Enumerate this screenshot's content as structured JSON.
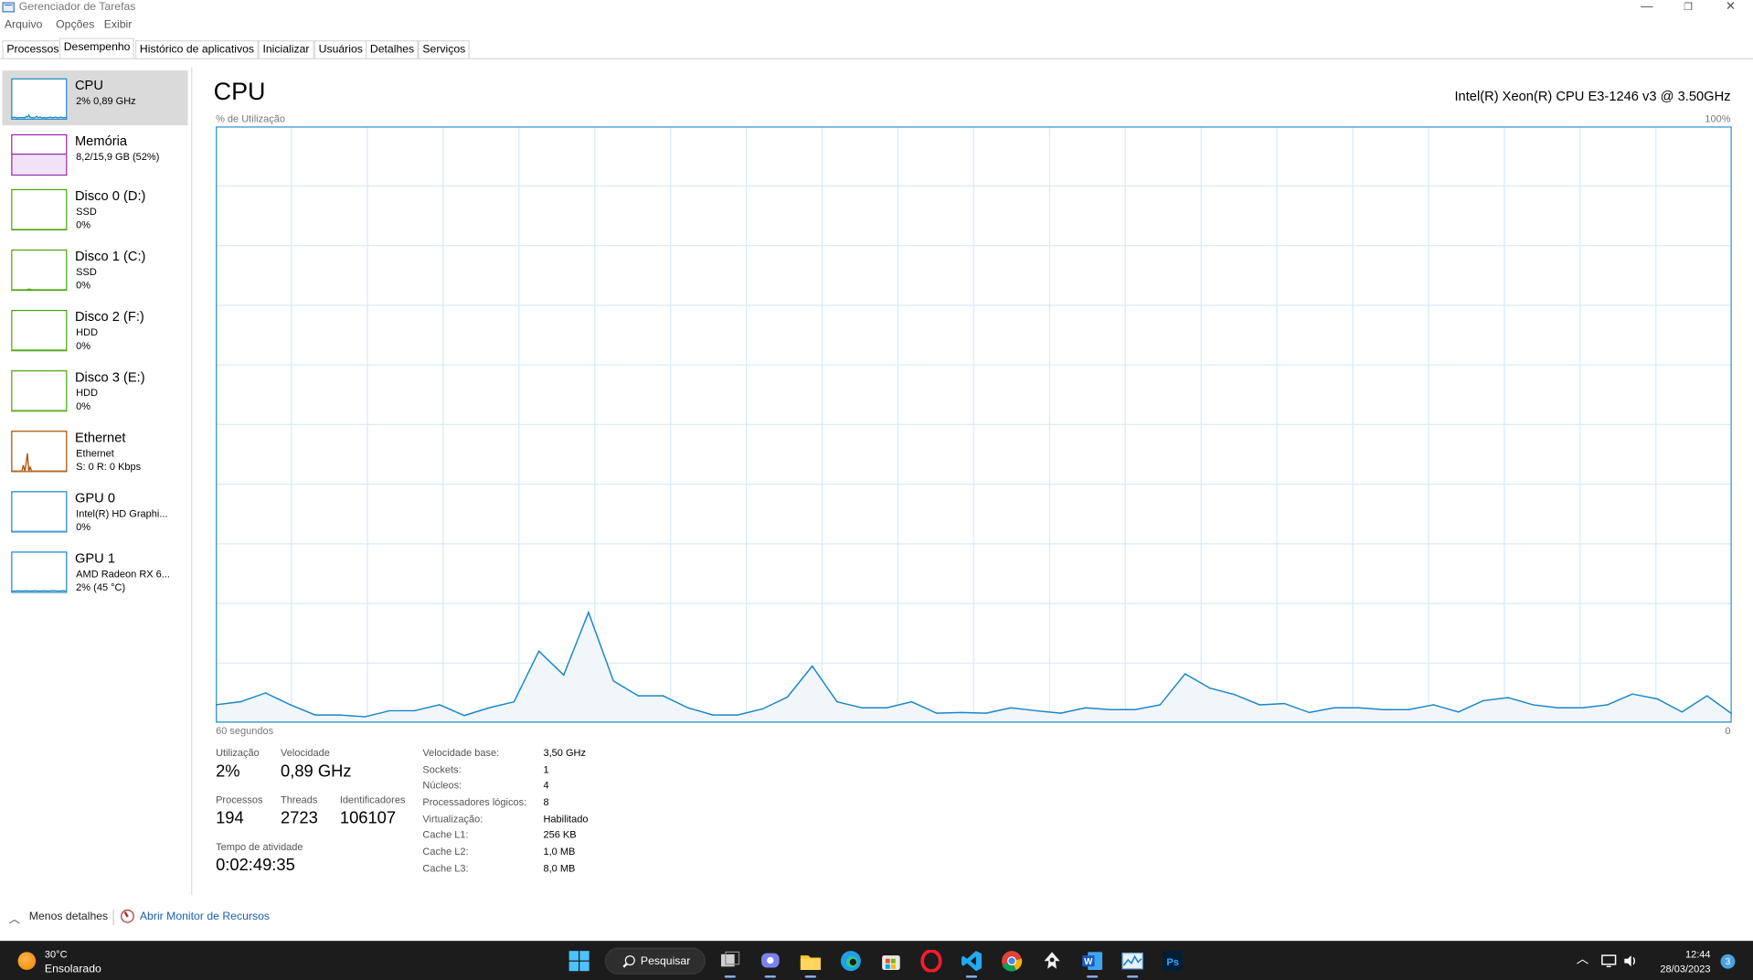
{
  "window": {
    "title": "Gerenciador de Tarefas",
    "controls": {
      "minimize": "—",
      "restore": "❐",
      "close": "✕"
    }
  },
  "menu": [
    "Arquivo",
    "Opções",
    "Exibir"
  ],
  "tabs": [
    "Processos",
    "Desempenho",
    "Histórico de aplicativos",
    "Inicializar",
    "Usuários",
    "Detalhes",
    "Serviços"
  ],
  "active_tab": "Desempenho",
  "sidebar": {
    "items": [
      {
        "title": "CPU",
        "line1": "2% 0,89 GHz",
        "line2": "",
        "color": "#1a86c7",
        "fill": "#dbeaf6",
        "selected": true,
        "spark": [
          3,
          3,
          4,
          2,
          2,
          2,
          3,
          3,
          2,
          3,
          2,
          6,
          4,
          9,
          3,
          3,
          2,
          2,
          3,
          6,
          3,
          3,
          4,
          2,
          2,
          3,
          2,
          2,
          3,
          3,
          4,
          2,
          3,
          3,
          4,
          3,
          2,
          3,
          4,
          3,
          2,
          3,
          2
        ]
      },
      {
        "title": "Memória",
        "line1": "8,2/15,9 GB (52%)",
        "line2": "",
        "color": "#9528b4",
        "fill": "#f1e2f6",
        "selected": false,
        "spark": [
          52,
          52,
          52,
          52,
          52,
          52,
          52,
          52,
          52,
          52
        ]
      },
      {
        "title": "Disco 0 (D:)",
        "line1": "SSD",
        "line2": "0%",
        "color": "#4da60c",
        "fill": "#e6f3dc",
        "selected": false,
        "spark": [
          0,
          0,
          0,
          0,
          0,
          0,
          0,
          0,
          0,
          0
        ]
      },
      {
        "title": "Disco 1 (C:)",
        "line1": "SSD",
        "line2": "0%",
        "color": "#4da60c",
        "fill": "#e6f3dc",
        "selected": false,
        "spark": [
          0,
          0,
          0,
          0,
          0,
          0,
          2,
          0,
          0,
          0,
          0,
          0,
          0,
          0,
          0,
          0,
          0,
          0,
          0,
          0
        ]
      },
      {
        "title": "Disco 2 (F:)",
        "line1": "HDD",
        "line2": "0%",
        "color": "#4da60c",
        "fill": "#e6f3dc",
        "selected": false,
        "spark": [
          0,
          0,
          0,
          0,
          0,
          0,
          0,
          0,
          0,
          0
        ]
      },
      {
        "title": "Disco 3 (E:)",
        "line1": "HDD",
        "line2": "0%",
        "color": "#4da60c",
        "fill": "#e6f3dc",
        "selected": false,
        "spark": [
          0,
          0,
          0,
          0,
          0,
          0,
          0,
          0,
          0,
          0
        ]
      },
      {
        "title": "Ethernet",
        "line1": "Ethernet",
        "line2": "S: 0 R: 0 Kbps",
        "color": "#a74f01",
        "fill": "#f5e4d6",
        "selected": false,
        "spark": [
          0,
          0,
          0,
          0,
          0,
          0,
          0,
          0,
          15,
          0,
          20,
          45,
          0,
          10,
          0,
          0,
          0,
          0,
          0,
          0,
          0,
          0,
          0,
          0,
          0,
          0,
          0,
          0,
          0,
          0,
          0,
          0,
          0,
          0,
          0,
          0,
          0,
          0,
          0,
          0
        ]
      },
      {
        "title": "GPU 0",
        "line1": "Intel(R) HD Graphi...",
        "line2": "0%",
        "color": "#1a86c7",
        "fill": "#dbeaf6",
        "selected": false,
        "spark": [
          0,
          0,
          0,
          0,
          0,
          0,
          0,
          0,
          0,
          0
        ]
      },
      {
        "title": "GPU 1",
        "line1": "AMD Radeon RX 6...",
        "line2": "2% (45 °C)",
        "color": "#1a86c7",
        "fill": "#dbeaf6",
        "selected": false,
        "spark": [
          2,
          2,
          3,
          2,
          2,
          3,
          2,
          2,
          3,
          2,
          2,
          3,
          2,
          2,
          3,
          3,
          2,
          2,
          3,
          2
        ]
      }
    ]
  },
  "main": {
    "title": "CPU",
    "cpu_model": "Intel(R) Xeon(R) CPU E3-1246 v3 @ 3.50GHz",
    "axis_label": "% de Utilização",
    "axis_max": "100%",
    "time_label": "60 segundos",
    "time_min": "0"
  },
  "chart_data": {
    "type": "area",
    "title": "",
    "xlabel": "",
    "ylabel": "% de Utilização",
    "ylim": [
      0,
      100
    ],
    "xlim": [
      60,
      0
    ],
    "grid": true,
    "series": [
      {
        "values": [
          3,
          3.5,
          5,
          3,
          1.3,
          1.3,
          1,
          2,
          2,
          3,
          1.2,
          2.5,
          3.5,
          12,
          8,
          18.5,
          7,
          4.5,
          4.5,
          2.5,
          1.3,
          1.3,
          2.3,
          4.3,
          9.5,
          3.5,
          2.5,
          2.5,
          3.5,
          1.6,
          1.7,
          1.6,
          2.5,
          2,
          1.6,
          2.5,
          2.2,
          2.2,
          3,
          8.2,
          5.8,
          4.7,
          3,
          3.2,
          1.7,
          2.5,
          2.5,
          2.2,
          2.2,
          3,
          1.8,
          3.7,
          4.2,
          3,
          2.5,
          2.5,
          3,
          4.8,
          4,
          1.8,
          4.5,
          1.5
        ]
      }
    ]
  },
  "stats": {
    "utilizacao": {
      "label": "Utilização",
      "value": "2%"
    },
    "velocidade": {
      "label": "Velocidade",
      "value": "0,89 GHz"
    },
    "processos": {
      "label": "Processos",
      "value": "194"
    },
    "threads": {
      "label": "Threads",
      "value": "2723"
    },
    "identificadores": {
      "label": "Identificadores",
      "value": "106107"
    },
    "tempo": {
      "label": "Tempo de atividade",
      "value": "0:02:49:35"
    }
  },
  "specs": [
    {
      "key": "Velocidade base:",
      "value": "3,50 GHz"
    },
    {
      "key": "Sockets:",
      "value": "1"
    },
    {
      "key": "Núcleos:",
      "value": "4"
    },
    {
      "key": "Processadores lógicos:",
      "value": "8"
    },
    {
      "key": "Virtualização:",
      "value": "Habilitado"
    },
    {
      "key": "Cache L1:",
      "value": "256 KB"
    },
    {
      "key": "Cache L2:",
      "value": "1,0 MB"
    },
    {
      "key": "Cache L3:",
      "value": "8,0 MB"
    }
  ],
  "footer": {
    "less_details": "Menos detalhes",
    "resource_monitor": "Abrir Monitor de Recursos"
  },
  "taskbar": {
    "weather_temp": "30°C",
    "weather_desc": "Ensolarado",
    "search_label": "Pesquisar",
    "apps": [
      "start-icon",
      "search-icon",
      "task-view-icon",
      "teams-chat-icon",
      "file-explorer-icon",
      "edge-icon",
      "store-icon",
      "opera-icon",
      "vscode-icon",
      "chrome-icon",
      "inkscape-icon",
      "word-icon",
      "task-manager-icon",
      "photoshop-icon"
    ],
    "clock_time": "12:44",
    "clock_date": "28/03/2023",
    "notifications": "3"
  },
  "colors": {
    "cpu_line": "#1a86c7",
    "cpu_fill": "#f1f6fb",
    "grid": "#d9eaf7",
    "link": "#1a5fb4",
    "taskbar": "#1c1c1c"
  }
}
